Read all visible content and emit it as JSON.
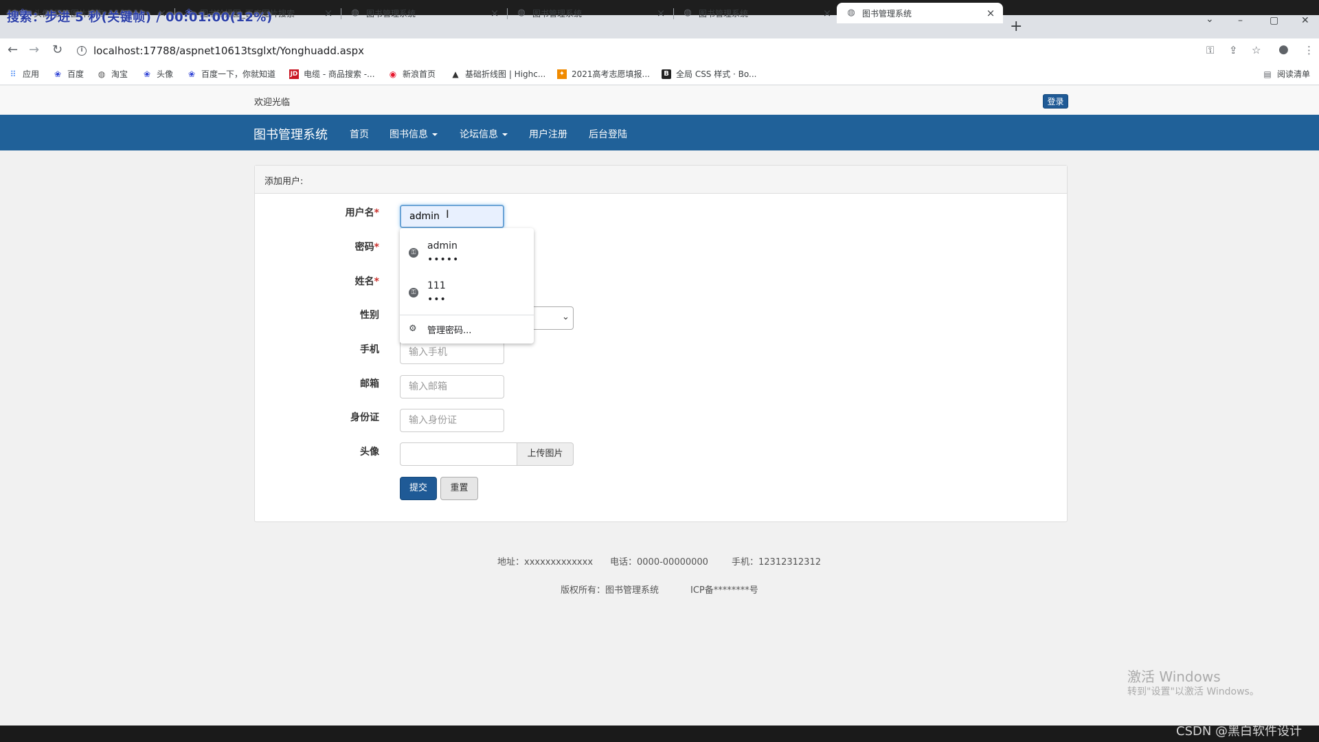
{
  "overlay": {
    "text": "搜索：步进 5 秒(关键帧) / 00:01:00(12%)"
  },
  "tabs": [
    {
      "label": "头像_百度图片搜索",
      "icon": "paw-icon"
    },
    {
      "label": "图书轮播图_百度图片搜索",
      "icon": "paw-icon"
    },
    {
      "label": "图书管理系统",
      "icon": "globe-icon"
    },
    {
      "label": "图书管理系统",
      "icon": "globe-icon"
    },
    {
      "label": "图书管理系统",
      "icon": "globe-icon"
    },
    {
      "label": "图书管理系统",
      "icon": "globe-icon"
    }
  ],
  "address": {
    "url": "localhost:17788/aspnet10613tsglxt/Yonghuadd.aspx"
  },
  "bookmarks": [
    {
      "label": "应用",
      "icon": "apps-grid-icon"
    },
    {
      "label": "百度",
      "icon": "paw-icon"
    },
    {
      "label": "淘宝",
      "icon": "globe-icon"
    },
    {
      "label": "头像",
      "icon": "paw-icon"
    },
    {
      "label": "百度一下，你就知道",
      "icon": "paw-icon"
    },
    {
      "label": "电缆 - 商品搜索 -...",
      "icon": "jd-icon"
    },
    {
      "label": "新浪首页",
      "icon": "weibo-icon"
    },
    {
      "label": "基础折线图 | Highc...",
      "icon": "highcharts-icon"
    },
    {
      "label": "2021高考志愿填报...",
      "icon": "school-icon"
    },
    {
      "label": "全局 CSS 样式 · Bo...",
      "icon": "bootstrap-icon"
    }
  ],
  "reading_list": "阅读清单",
  "site": {
    "welcome": "欢迎光临",
    "login": "登录",
    "brand": "图书管理系统",
    "nav": [
      {
        "label": "首页"
      },
      {
        "label": "图书信息"
      },
      {
        "label": "论坛信息"
      },
      {
        "label": "用户注册"
      },
      {
        "label": "后台登陆"
      }
    ]
  },
  "form": {
    "title": "添加用户:",
    "fields": {
      "username": {
        "label": "用户名",
        "value": "admin"
      },
      "password": {
        "label": "密码"
      },
      "name": {
        "label": "姓名"
      },
      "gender": {
        "label": "性别"
      },
      "phone": {
        "label": "手机",
        "placeholder": "输入手机"
      },
      "email": {
        "label": "邮箱",
        "placeholder": "输入邮箱"
      },
      "idcard": {
        "label": "身份证",
        "placeholder": "输入身份证"
      },
      "avatar": {
        "label": "头像",
        "upload": "上传图片"
      }
    },
    "required_mark": "*",
    "submit": "提交",
    "reset": "重置"
  },
  "autofill": {
    "items": [
      {
        "user": "admin",
        "pass": "•••••"
      },
      {
        "user": "111",
        "pass": "•••"
      }
    ],
    "manage": "管理密码..."
  },
  "footer": {
    "address": "地址：xxxxxxxxxxxxx",
    "tel": "电话：0000-00000000",
    "mobile": "手机：12312312312",
    "copyright": "版权所有：图书管理系统",
    "icp": "ICP备********号"
  },
  "watermark": {
    "line1": "激活 Windows",
    "line2": "转到\"设置\"以激活 Windows。"
  },
  "csdn": "CSDN @黑白软件设计"
}
